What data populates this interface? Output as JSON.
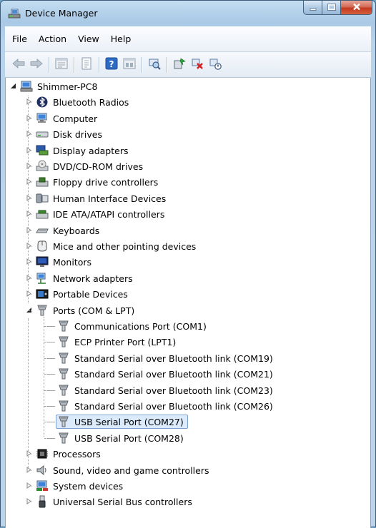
{
  "window": {
    "title": "Device Manager"
  },
  "menu": [
    "File",
    "Action",
    "View",
    "Help"
  ],
  "toolbar": {
    "buttons": [
      "back-icon",
      "forward-icon",
      "properties-list-icon",
      "document-icon",
      "help-icon",
      "show-hidden-icon",
      "scan-hardware-icon",
      "update-driver-icon",
      "uninstall-icon",
      "disable-icon"
    ]
  },
  "tree": {
    "root": "Shimmer-PC8",
    "categories": [
      {
        "label": "Bluetooth Radios",
        "icon": "bluetooth-icon"
      },
      {
        "label": "Computer",
        "icon": "computer-icon"
      },
      {
        "label": "Disk drives",
        "icon": "disk-drive-icon"
      },
      {
        "label": "Display adapters",
        "icon": "display-adapter-icon"
      },
      {
        "label": "DVD/CD-ROM drives",
        "icon": "dvd-drive-icon"
      },
      {
        "label": "Floppy drive controllers",
        "icon": "floppy-controller-icon"
      },
      {
        "label": "Human Interface Devices",
        "icon": "hid-icon"
      },
      {
        "label": "IDE ATA/ATAPI controllers",
        "icon": "ide-controller-icon"
      },
      {
        "label": "Keyboards",
        "icon": "keyboard-icon"
      },
      {
        "label": "Mice and other pointing devices",
        "icon": "mouse-icon"
      },
      {
        "label": "Monitors",
        "icon": "monitor-icon"
      },
      {
        "label": "Network adapters",
        "icon": "network-adapter-icon"
      },
      {
        "label": "Portable Devices",
        "icon": "portable-device-icon"
      },
      {
        "label": "Ports (COM & LPT)",
        "icon": "port-icon"
      }
    ],
    "ports": [
      "Communications Port (COM1)",
      "ECP Printer Port (LPT1)",
      "Standard Serial over Bluetooth link (COM19)",
      "Standard Serial over Bluetooth link (COM21)",
      "Standard Serial over Bluetooth link (COM23)",
      "Standard Serial over Bluetooth link (COM26)",
      "USB Serial Port (COM27)",
      "USB Serial Port (COM28)"
    ],
    "selected_port": "USB Serial Port (COM27)",
    "after_ports": [
      {
        "label": "Processors",
        "icon": "processor-icon"
      },
      {
        "label": "Sound, video and game controllers",
        "icon": "sound-icon"
      },
      {
        "label": "System devices",
        "icon": "system-devices-icon"
      },
      {
        "label": "Universal Serial Bus controllers",
        "icon": "usb-icon"
      }
    ]
  }
}
